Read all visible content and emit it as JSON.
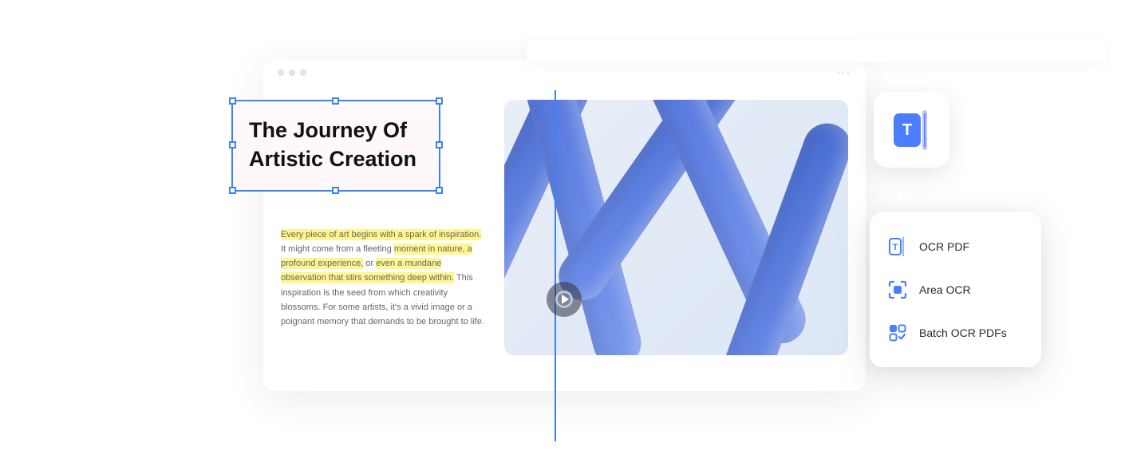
{
  "document": {
    "title_line1": "The Journey Of",
    "title_line2": "Artistic Creation",
    "body_highlighted_1": "Every piece of art begins with a spark of inspiration.",
    "body_plain_1": " It might come from a fleeting ",
    "body_highlighted_2": "moment in nature, a profound experience,",
    "body_plain_2": " or ",
    "body_highlighted_3": "even a mundane observation that stirs something deep within.",
    "body_plain_3": " This inspiration is the seed from which creativity blossoms. For some artists, it's a vivid image or a poignant memory that demands to be brought to life."
  },
  "menu": {
    "items": [
      {
        "label": "OCR PDF",
        "icon": "text-ocr-icon"
      },
      {
        "label": "Area OCR",
        "icon": "area-ocr-icon"
      },
      {
        "label": "Batch OCR PDFs",
        "icon": "batch-ocr-icon"
      }
    ]
  }
}
